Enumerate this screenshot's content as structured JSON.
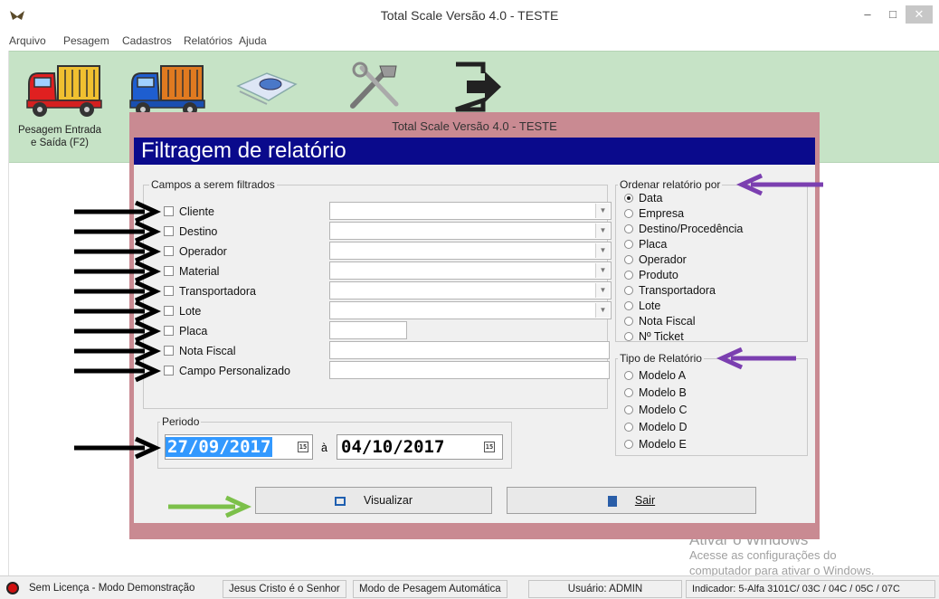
{
  "window": {
    "title": "Total Scale Versão 4.0  -  TESTE"
  },
  "menu": [
    "Arquivo",
    "Pesagem",
    "Cadastros",
    "Relatórios",
    "Ajuda"
  ],
  "toolbar": {
    "weigh_label": "Pesagem Entrada e Saída (F2)"
  },
  "dialog": {
    "title": "Total Scale Versão 4.0  -  TESTE",
    "header": "Filtragem de relatório",
    "fields_group": "Campos a serem filtrados",
    "fields": [
      "Cliente",
      "Destino",
      "Operador",
      "Material",
      "Transportadora",
      "Lote",
      "Placa",
      "Nota Fiscal",
      "Campo Personalizado"
    ],
    "order_group": "Ordenar relatório por",
    "order_options": [
      "Data",
      "Empresa",
      "Destino/Procedência",
      "Placa",
      "Operador",
      "Produto",
      "Transportadora",
      "Lote",
      "Nota Fiscal",
      "Nº Ticket"
    ],
    "order_selected": "Data",
    "type_group": "Tipo de Relatório",
    "type_options": [
      "Modelo A",
      "Modelo B",
      "Modelo C",
      "Modelo D",
      "Modelo E"
    ],
    "period_group": "Periodo",
    "date_from": "27/09/2017",
    "date_sep": "à",
    "date_to": "04/10/2017",
    "btn_view": "Visualizar",
    "btn_exit": "Sair"
  },
  "watermark": {
    "title": "Ativar o Windows",
    "line1": "Acesse as configurações do",
    "line2": "computador para ativar o Windows."
  },
  "status": {
    "license": "Sem Licença - Modo Demonstração",
    "motto": "Jesus Cristo é o Senhor",
    "mode": "Modo de Pesagem Automática",
    "user": "Usuário: ADMIN",
    "indicator": "Indicador: 5-Alfa 3101C/ 03C / 04C / 05C / 07C"
  },
  "colors": {
    "dialog_border": "#c98a92",
    "header_bg": "#0a0a8c",
    "toolbar_bg": "#c6e3c6",
    "arrow_black": "#000000",
    "arrow_purple": "#7b3fb0",
    "arrow_green": "#7cc04a"
  }
}
